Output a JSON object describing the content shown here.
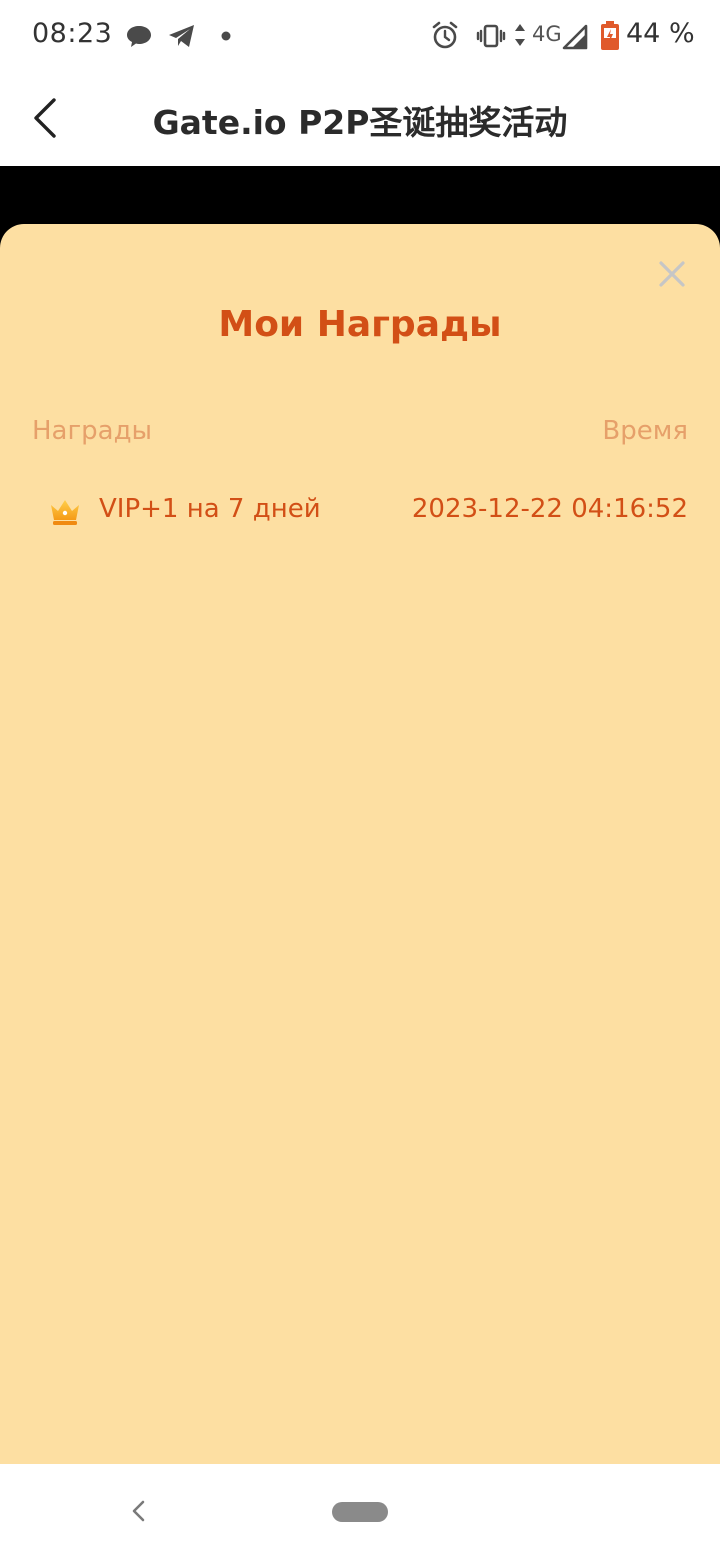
{
  "status_bar": {
    "time": "08:23",
    "network": "4G",
    "battery": "44 %",
    "icons": [
      "chat-bubble-icon",
      "telegram-icon",
      "dot-icon",
      "alarm-icon",
      "vibrate-icon",
      "data-arrows-icon",
      "signal-icon",
      "battery-icon"
    ]
  },
  "header": {
    "title": "Gate.io P2P圣诞抽奖活动",
    "back_icon": "chevron-left-icon"
  },
  "sheet": {
    "title": "Мои Награды",
    "close_icon": "close-icon",
    "columns": {
      "rewards": "Награды",
      "time": "Время"
    },
    "rows": [
      {
        "icon": "crown-icon",
        "name": "VIP+1 на 7 дней",
        "time": "2023-12-22 04:16:52"
      }
    ]
  },
  "nav_bar": {
    "icons": [
      "nav-back-icon",
      "home-pill-icon"
    ]
  },
  "colors": {
    "accent": "#d24f16",
    "muted": "#e6a06a",
    "sheet_bg": "#fddfa2"
  }
}
